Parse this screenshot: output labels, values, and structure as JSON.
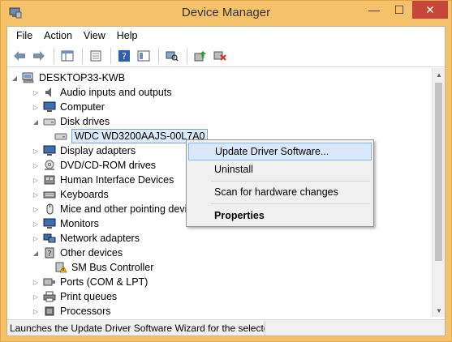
{
  "window": {
    "title": "Device Manager",
    "minimize": "—",
    "maximize": "☐",
    "close": "✕"
  },
  "menu": [
    "File",
    "Action",
    "View",
    "Help"
  ],
  "tree": {
    "root": "DESKTOP33-KWB",
    "items": [
      {
        "label": "Audio inputs and outputs",
        "expander": "▷",
        "icon": "speaker-icon"
      },
      {
        "label": "Computer",
        "expander": "▷",
        "icon": "computer-icon"
      },
      {
        "label": "Disk drives",
        "expander": "◢",
        "icon": "disk-drive-icon"
      },
      {
        "label": "WDC WD3200AAJS-00L7A0",
        "expander": "",
        "icon": "disk-drive-icon",
        "child": true,
        "selected": true
      },
      {
        "label": "Display adapters",
        "expander": "▷",
        "icon": "monitor-icon"
      },
      {
        "label": "DVD/CD-ROM drives",
        "expander": "▷",
        "icon": "dvd-icon"
      },
      {
        "label": "Human Interface Devices",
        "expander": "▷",
        "icon": "hid-icon"
      },
      {
        "label": "Keyboards",
        "expander": "▷",
        "icon": "keyboard-icon"
      },
      {
        "label": "Mice and other pointing devic",
        "expander": "▷",
        "icon": "mouse-icon"
      },
      {
        "label": "Monitors",
        "expander": "▷",
        "icon": "monitor-icon"
      },
      {
        "label": "Network adapters",
        "expander": "▷",
        "icon": "network-icon"
      },
      {
        "label": "Other devices",
        "expander": "◢",
        "icon": "other-devices-icon"
      },
      {
        "label": "SM Bus Controller",
        "expander": "",
        "icon": "warning-device-icon",
        "child": true
      },
      {
        "label": "Ports (COM & LPT)",
        "expander": "▷",
        "icon": "port-icon"
      },
      {
        "label": "Print queues",
        "expander": "▷",
        "icon": "printer-icon"
      },
      {
        "label": "Processors",
        "expander": "▷",
        "icon": "processor-icon"
      }
    ]
  },
  "context_menu": {
    "update": "Update Driver Software...",
    "uninstall": "Uninstall",
    "scan": "Scan for hardware changes",
    "properties": "Properties"
  },
  "status": "Launches the Update Driver Software Wizard for the selected",
  "colors": {
    "title_bar": "#f5c26b",
    "close_button": "#c7463a",
    "selection": "#dcebfc",
    "highlight_border": "#8fb8ea"
  }
}
